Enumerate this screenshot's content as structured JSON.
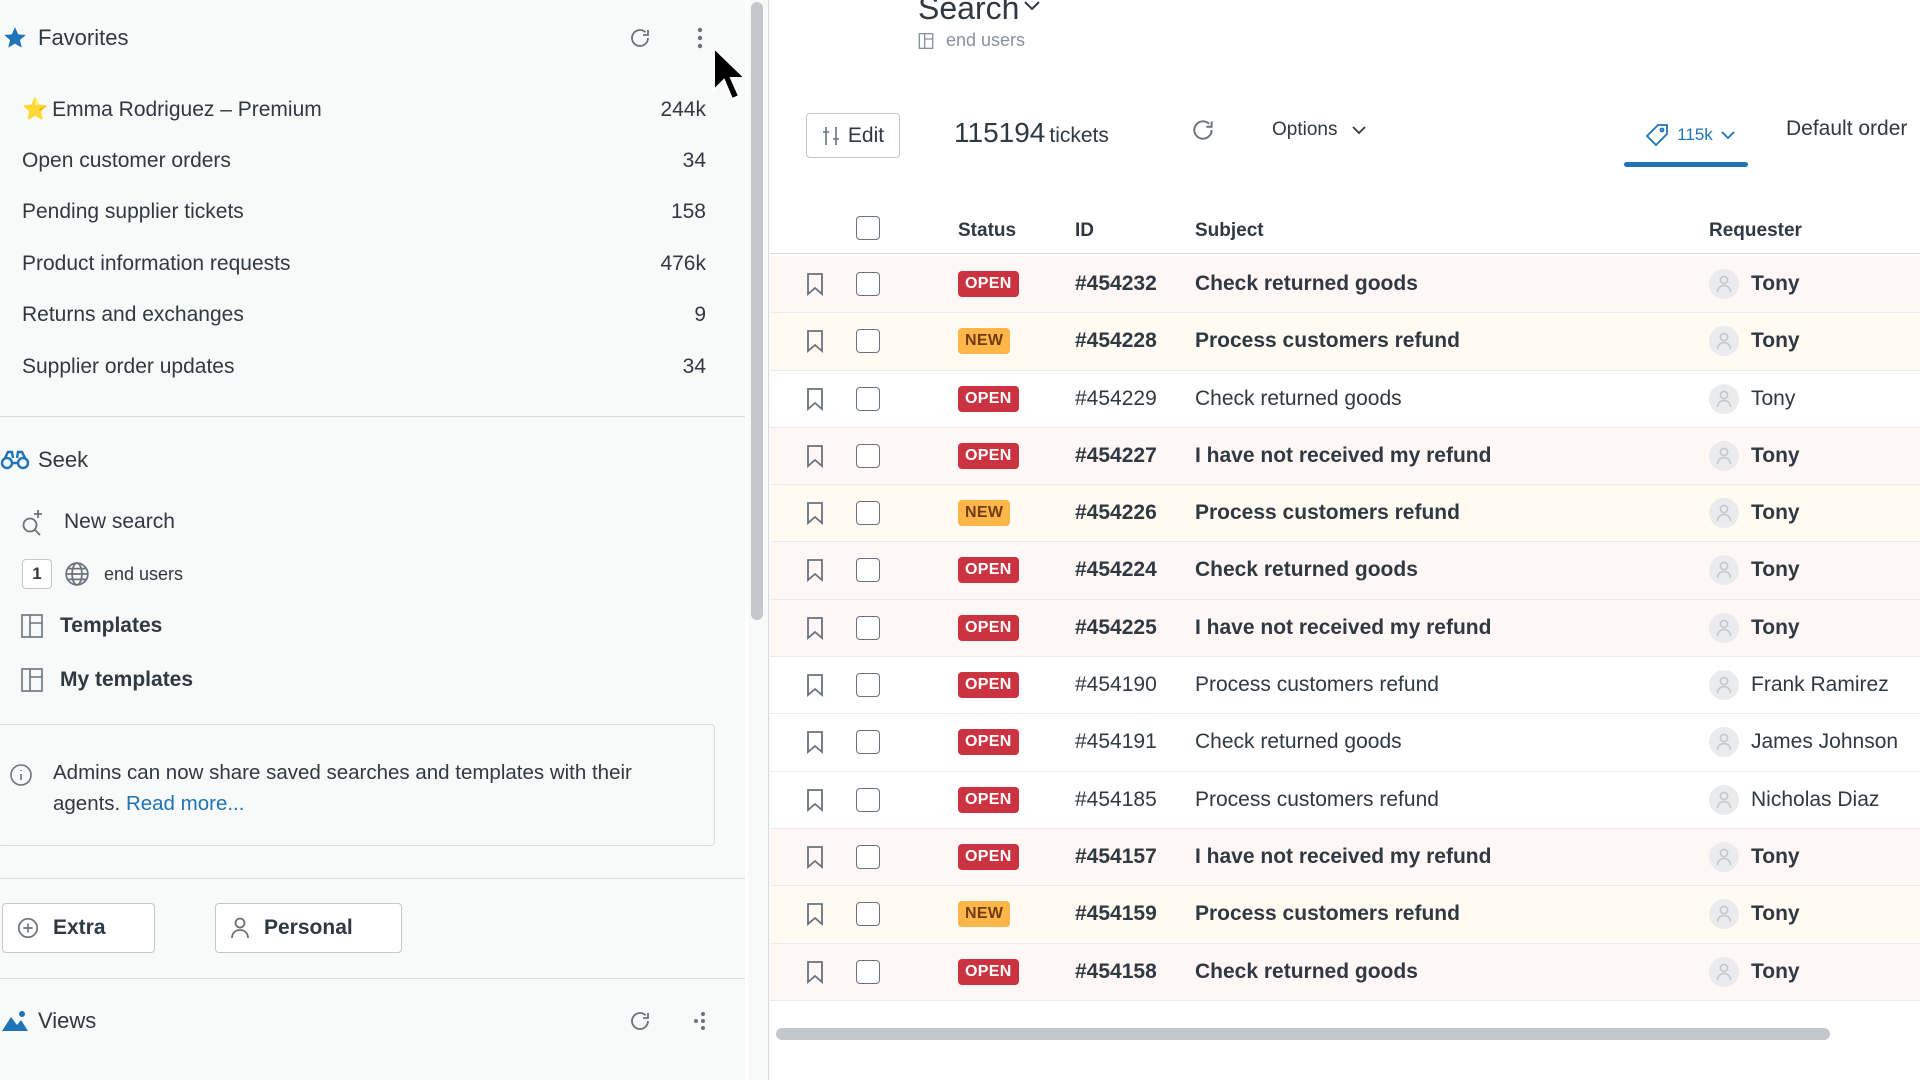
{
  "colors": {
    "accent": "#1f73b7",
    "open": "#cc3340",
    "new": "#ffb648",
    "text": "#2f3941",
    "muted": "#87929d"
  },
  "favorites": {
    "title": "Favorites",
    "icon": "star-icon",
    "items": [
      {
        "label": "Emma Rodriguez – Premium",
        "count": "244k",
        "starred": true
      },
      {
        "label": "Open customer orders",
        "count": "34"
      },
      {
        "label": "Pending supplier tickets",
        "count": "158"
      },
      {
        "label": "Product information requests",
        "count": "476k"
      },
      {
        "label": "Returns and exchanges",
        "count": "9"
      },
      {
        "label": "Supplier order updates",
        "count": "34"
      }
    ]
  },
  "seek": {
    "title": "Seek",
    "icon": "binoculars-icon",
    "new_search": "New search",
    "search_count": "1",
    "search_label": "end users",
    "templates": "Templates",
    "my_templates": "My templates"
  },
  "notice": {
    "text": "Admins can now share saved searches and templates with their agents.",
    "link": "Read more..."
  },
  "buttons": {
    "extra": "Extra",
    "personal": "Personal"
  },
  "views": {
    "title": "Views",
    "icon": "mountain-icon"
  },
  "main": {
    "title": "Search",
    "subtitle": "end users",
    "edit": "Edit",
    "count": "115194",
    "count_word": "tickets",
    "options": "Options",
    "tag_count": "115k",
    "order": "Default order",
    "columns": {
      "status": "Status",
      "id": "ID",
      "subject": "Subject",
      "requester": "Requester"
    },
    "rows": [
      {
        "status": "OPEN",
        "id": "#454232",
        "subject": "Check returned goods",
        "requester": "Tony",
        "unread": true
      },
      {
        "status": "NEW",
        "id": "#454228",
        "subject": "Process customers refund",
        "requester": "Tony",
        "unread": true
      },
      {
        "status": "OPEN",
        "id": "#454229",
        "subject": "Check returned goods",
        "requester": "Tony",
        "unread": false
      },
      {
        "status": "OPEN",
        "id": "#454227",
        "subject": "I have not received my refund",
        "requester": "Tony",
        "unread": true
      },
      {
        "status": "NEW",
        "id": "#454226",
        "subject": "Process customers refund",
        "requester": "Tony",
        "unread": true
      },
      {
        "status": "OPEN",
        "id": "#454224",
        "subject": "Check returned goods",
        "requester": "Tony",
        "unread": true
      },
      {
        "status": "OPEN",
        "id": "#454225",
        "subject": "I have not received my refund",
        "requester": "Tony",
        "unread": true
      },
      {
        "status": "OPEN",
        "id": "#454190",
        "subject": "Process customers refund",
        "requester": "Frank Ramirez",
        "unread": false
      },
      {
        "status": "OPEN",
        "id": "#454191",
        "subject": "Check returned goods",
        "requester": "James Johnson",
        "unread": false
      },
      {
        "status": "OPEN",
        "id": "#454185",
        "subject": "Process customers refund",
        "requester": "Nicholas Diaz",
        "unread": false
      },
      {
        "status": "OPEN",
        "id": "#454157",
        "subject": "I have not received my refund",
        "requester": "Tony",
        "unread": true
      },
      {
        "status": "NEW",
        "id": "#454159",
        "subject": "Process customers refund",
        "requester": "Tony",
        "unread": true
      },
      {
        "status": "OPEN",
        "id": "#454158",
        "subject": "Check returned goods",
        "requester": "Tony",
        "unread": true
      }
    ]
  }
}
